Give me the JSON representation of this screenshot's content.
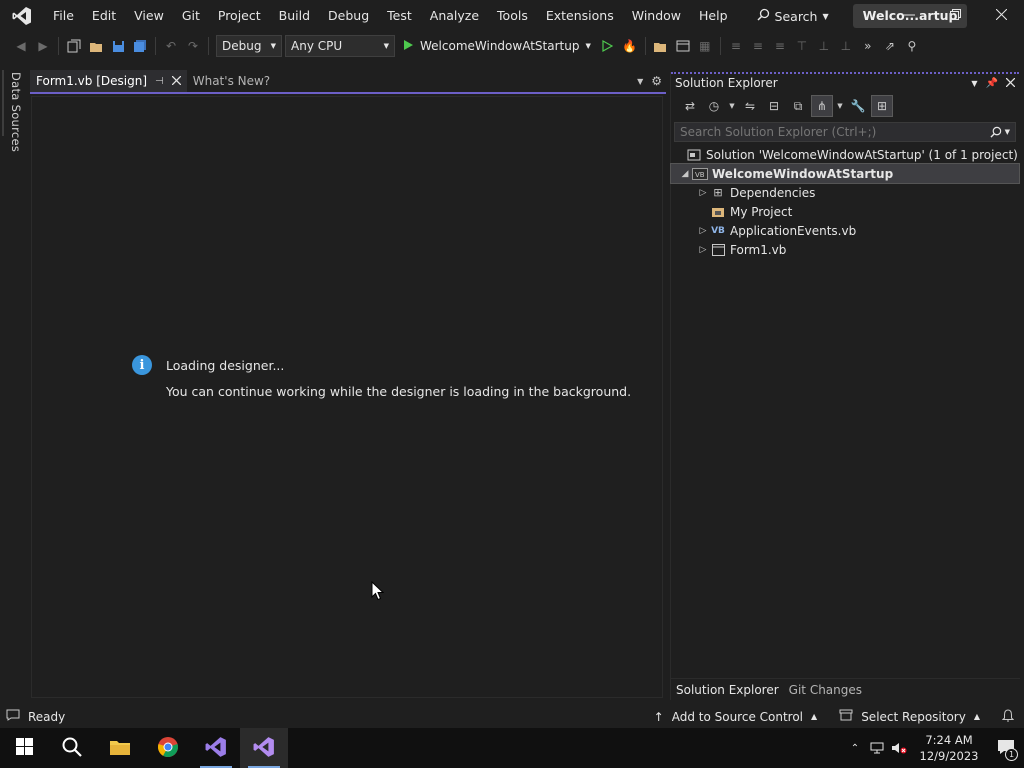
{
  "menu": {
    "items": [
      "File",
      "Edit",
      "View",
      "Git",
      "Project",
      "Build",
      "Debug",
      "Test",
      "Analyze",
      "Tools",
      "Extensions",
      "Window",
      "Help"
    ],
    "search_label": "Search",
    "window_title": "Welco...artup"
  },
  "toolbar": {
    "configuration": "Debug",
    "platform": "Any CPU",
    "startup_project": "WelcomeWindowAtStartup"
  },
  "left_panel": {
    "data_sources_label": "Data Sources"
  },
  "document_tabs": {
    "active_label": "Form1.vb [Design]",
    "inactive_label": "What's New?"
  },
  "designer": {
    "loading_title": "Loading designer...",
    "loading_message": "You can continue working while the designer is loading in the background."
  },
  "solution_explorer": {
    "title": "Solution Explorer",
    "search_placeholder": "Search Solution Explorer (Ctrl+;)",
    "solution_label": "Solution 'WelcomeWindowAtStartup' (1 of 1 project)",
    "project_label": "WelcomeWindowAtStartup",
    "items": [
      "Dependencies",
      "My Project",
      "ApplicationEvents.vb",
      "Form1.vb"
    ],
    "bottom_tabs": [
      "Solution Explorer",
      "Git Changes"
    ]
  },
  "statusbar": {
    "status": "Ready",
    "add_to_source_control": "Add to Source Control",
    "select_repository": "Select Repository"
  },
  "taskbar": {
    "time": "7:24 AM",
    "date": "12/9/2023",
    "notification_count": "1"
  },
  "colors": {
    "accent": "#6c5fc7",
    "background": "#1f1f1f",
    "info": "#3a96dd"
  }
}
